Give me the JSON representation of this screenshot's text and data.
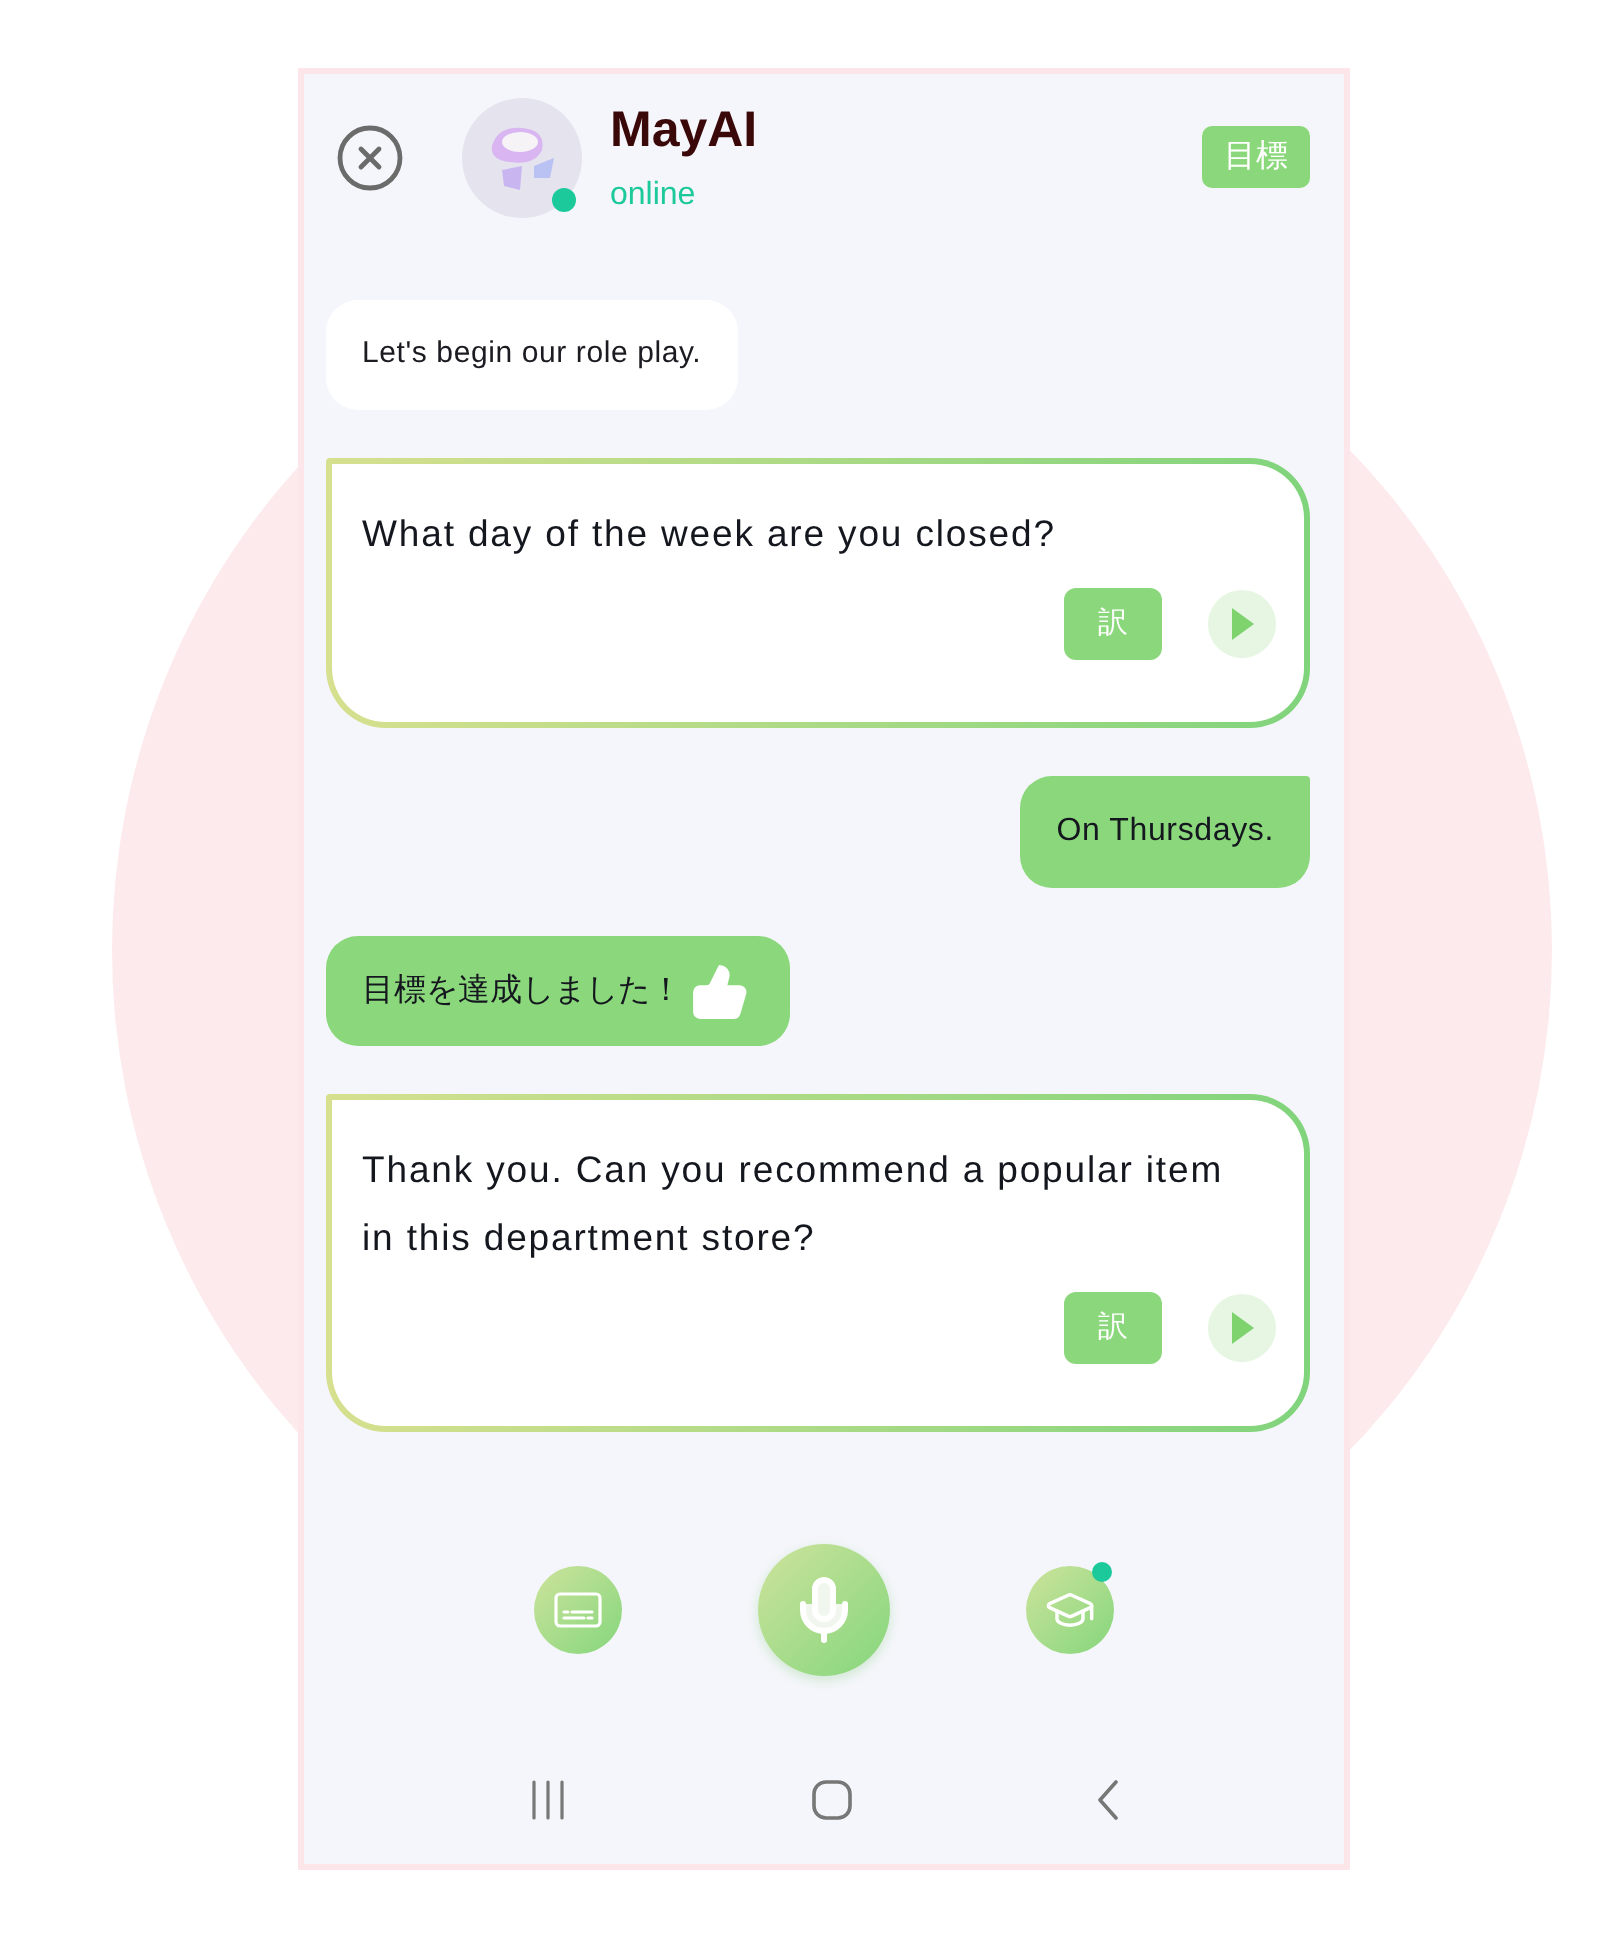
{
  "header": {
    "title": "MayAI",
    "status": "online",
    "online": true,
    "goal_button": "目標"
  },
  "messages": [
    {
      "kind": "bot",
      "text": "Let's begin our role play."
    },
    {
      "kind": "question",
      "text": "What day of the week are you closed?",
      "translate_button": "訳"
    },
    {
      "kind": "user",
      "text": "On Thursdays."
    },
    {
      "kind": "goal",
      "text": "目標を達成しました！"
    },
    {
      "kind": "question",
      "text": "Thank you. Can you recommend a popular item in this department store?",
      "translate_button": "訳"
    }
  ],
  "controls": [
    {
      "kind": "subtitles",
      "badge": false
    },
    {
      "kind": "microphone",
      "badge": false
    },
    {
      "kind": "course",
      "badge": true
    }
  ]
}
